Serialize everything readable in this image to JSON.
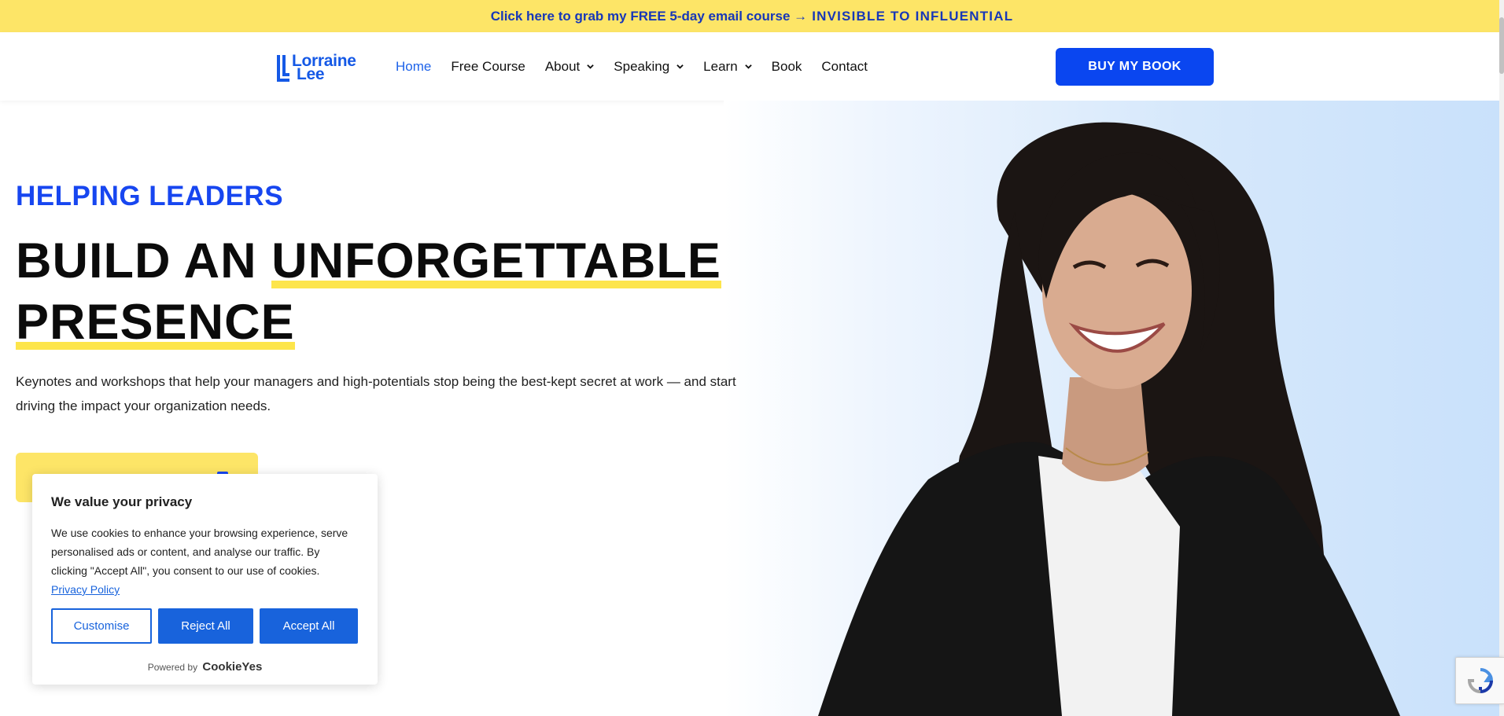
{
  "banner": {
    "bold_text": "Click here to grab my FREE 5-day email course →",
    "caps_text": "INVISIBLE TO INFLUENTIAL"
  },
  "header": {
    "logo": {
      "line1": "Lorraine",
      "line2": "Lee"
    },
    "nav": [
      {
        "label": "Home",
        "active": true
      },
      {
        "label": "Free Course"
      },
      {
        "label": "About",
        "dropdown": true
      },
      {
        "label": "Speaking",
        "dropdown": true
      },
      {
        "label": "Learn",
        "dropdown": true
      },
      {
        "label": "Book"
      },
      {
        "label": "Contact"
      }
    ],
    "cta_label": "BUY MY BOOK"
  },
  "hero": {
    "kicker": "HELPING LEADERS",
    "headline_plain": "BUILD AN ",
    "headline_highlight_1": "UNFORGETTABLE",
    "headline_highlight_2": "PRESENCE",
    "subtext": "Keynotes and workshops that help your managers and high-potentials stop being the best-kept secret at work — and start driving the impact your organization needs."
  },
  "cookie_banner": {
    "title": "We value your privacy",
    "body": "We use cookies to enhance your browsing experience, serve personalised ads or content, and analyse our traffic. By clicking \"Accept All\", you consent to our use of cookies.",
    "privacy_link": "Privacy Policy",
    "customise_label": "Customise",
    "reject_label": "Reject All",
    "accept_label": "Accept All",
    "powered_by": "Powered by",
    "brand": "CookieYes"
  },
  "colors": {
    "banner_bg": "#fde567",
    "brand_blue": "#0a46f0",
    "cookie_blue": "#1863dc",
    "highlight_yellow": "#fde54b"
  }
}
